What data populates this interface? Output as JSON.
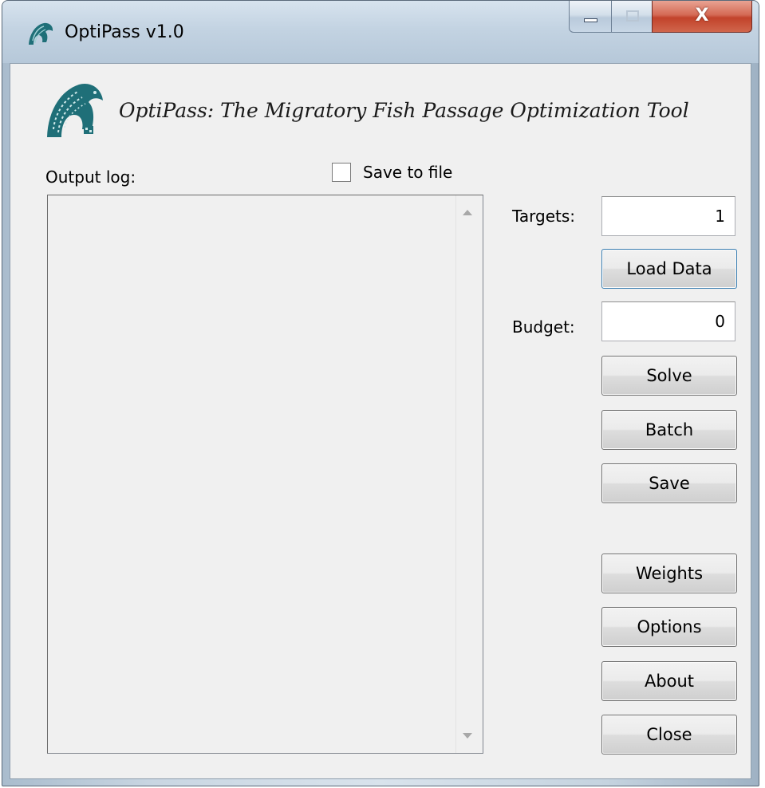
{
  "window": {
    "title": "OptiPass v1.0",
    "close_glyph": "X"
  },
  "header": {
    "app_heading": "OptiPass: The Migratory Fish Passage Optimization Tool",
    "logo_icon": "fish-logo-icon"
  },
  "output": {
    "label": "Output log:",
    "save_to_file_label": "Save to file",
    "save_to_file_checked": false,
    "log_text": ""
  },
  "controls": {
    "targets_label": "Targets:",
    "targets_value": "1",
    "budget_label": "Budget:",
    "budget_value": "0",
    "buttons": {
      "load_data": "Load Data",
      "solve": "Solve",
      "batch": "Batch",
      "save": "Save",
      "weights": "Weights",
      "options": "Options",
      "about": "About",
      "close": "Close"
    }
  },
  "colors": {
    "logo": "#1f6f78",
    "client_bg": "#f0f0f0",
    "close_button": "#c2432b"
  }
}
